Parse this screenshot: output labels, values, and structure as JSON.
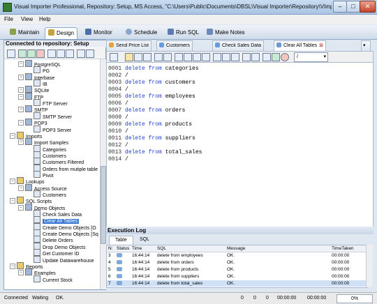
{
  "title_bar": {
    "text": "Visual Importer Professional, Repository: Setup, MS Access, \"C:\\Users\\Public\\Documents\\DBSL\\Visual Importer\\Repository\\VImpRepository.m..."
  },
  "menu": [
    "File",
    "View",
    "Help"
  ],
  "module_tabs": [
    "Maintain",
    "Design",
    "Monitor",
    "Schedule",
    "Run SQL",
    "Make Notes"
  ],
  "active_module": "Design",
  "left_panel": {
    "header": "Connected to repository: Setup",
    "tree": [
      {
        "label": "PostgreSQL",
        "level": 2
      },
      {
        "label": "PG",
        "level": 3
      },
      {
        "label": "Interbase",
        "level": 2
      },
      {
        "label": "IB",
        "level": 3
      },
      {
        "label": "SQLite",
        "level": 2
      },
      {
        "label": "FTP",
        "level": 2
      },
      {
        "label": "FTP Server",
        "level": 3
      },
      {
        "label": "SMTP",
        "level": 2
      },
      {
        "label": "SMTP Server",
        "level": 3
      },
      {
        "label": "POP3",
        "level": 2
      },
      {
        "label": "POP3 Server",
        "level": 3
      },
      {
        "label": "Imports",
        "level": 1
      },
      {
        "label": "Import Samples",
        "level": 2
      },
      {
        "label": "Categories",
        "level": 3
      },
      {
        "label": "Customers",
        "level": 3
      },
      {
        "label": "Customers Filtered",
        "level": 3
      },
      {
        "label": "Orders from mutiple table",
        "level": 3
      },
      {
        "label": "Pivot",
        "level": 3
      },
      {
        "label": "Lookups",
        "level": 1
      },
      {
        "label": "Access Source",
        "level": 2
      },
      {
        "label": "Customers",
        "level": 3
      },
      {
        "label": "SQL Scripts",
        "level": 1
      },
      {
        "label": "Demo Objects",
        "level": 2
      },
      {
        "label": "Check Sales Data",
        "level": 3
      },
      {
        "label": "Clear All Tables",
        "level": 3
      },
      {
        "label": "Create Demo Objects [O",
        "level": 3
      },
      {
        "label": "Create Demo Objects [Sq",
        "level": 3
      },
      {
        "label": "Delete Orders",
        "level": 3
      },
      {
        "label": "Drop Demo Objects",
        "level": 3
      },
      {
        "label": "Get Customer ID",
        "level": 3
      },
      {
        "label": "Update Datawarehouse",
        "level": 3
      },
      {
        "label": "Reports",
        "level": 1
      },
      {
        "label": "Examples",
        "level": 2
      },
      {
        "label": "Current Stock",
        "level": 3
      }
    ],
    "selected_item": "Clear All Tables"
  },
  "doc_tabs": [
    "Send Price List",
    "Customers",
    "Check Sales Data",
    "Clear All Tables"
  ],
  "active_doc_tab": "Clear All Tables",
  "editor_toolbar": {
    "delimiter_value": "/"
  },
  "editor_lines": [
    {
      "n": "0001",
      "kw": "delete from",
      "rest": " categories"
    },
    {
      "n": "0002",
      "kw": "",
      "rest": "/"
    },
    {
      "n": "0003",
      "kw": "delete from",
      "rest": " customers"
    },
    {
      "n": "0004",
      "kw": "",
      "rest": "/"
    },
    {
      "n": "0005",
      "kw": "delete from",
      "rest": " employees"
    },
    {
      "n": "0006",
      "kw": "",
      "rest": "/"
    },
    {
      "n": "0007",
      "kw": "delete from",
      "rest": " orders"
    },
    {
      "n": "0008",
      "kw": "",
      "rest": "/"
    },
    {
      "n": "0009",
      "kw": "delete from",
      "rest": " products"
    },
    {
      "n": "0010",
      "kw": "",
      "rest": "/"
    },
    {
      "n": "0011",
      "kw": "delete from",
      "rest": " suppliers"
    },
    {
      "n": "0012",
      "kw": "",
      "rest": "/"
    },
    {
      "n": "0013",
      "kw": "delete from",
      "rest": " total_sales"
    },
    {
      "n": "0014",
      "kw": "",
      "rest": "/"
    }
  ],
  "execution_log": {
    "title": "Execution Log",
    "tabs": [
      "Table",
      "SQL"
    ],
    "columns": [
      "N:",
      "Status",
      "Time",
      "SQL",
      "Message",
      "TimeTaken"
    ],
    "rows": [
      {
        "n": "3",
        "time": "16:44:14",
        "sql": "delete from employees",
        "message": "OK.",
        "taken": "00:00:00"
      },
      {
        "n": "4",
        "time": "16:44:14",
        "sql": "delete from orders",
        "message": "OK.",
        "taken": "00:00:00"
      },
      {
        "n": "5",
        "time": "16:44:14",
        "sql": "delete from products",
        "message": "OK.",
        "taken": "00:00:00"
      },
      {
        "n": "6",
        "time": "16:44:14",
        "sql": "delete from suppliers",
        "message": "OK.",
        "taken": "00:00:00"
      },
      {
        "n": "7",
        "time": "16:44:14",
        "sql": "delete from total_sales",
        "message": "OK.",
        "taken": "00:00:00"
      }
    ]
  },
  "status_bar": {
    "connected": "Connected",
    "state": "Waiting",
    "message": "OK.",
    "counters": [
      "0",
      "0",
      "0",
      "00:00:00",
      "00:00:00"
    ],
    "progress_text": "0%"
  }
}
